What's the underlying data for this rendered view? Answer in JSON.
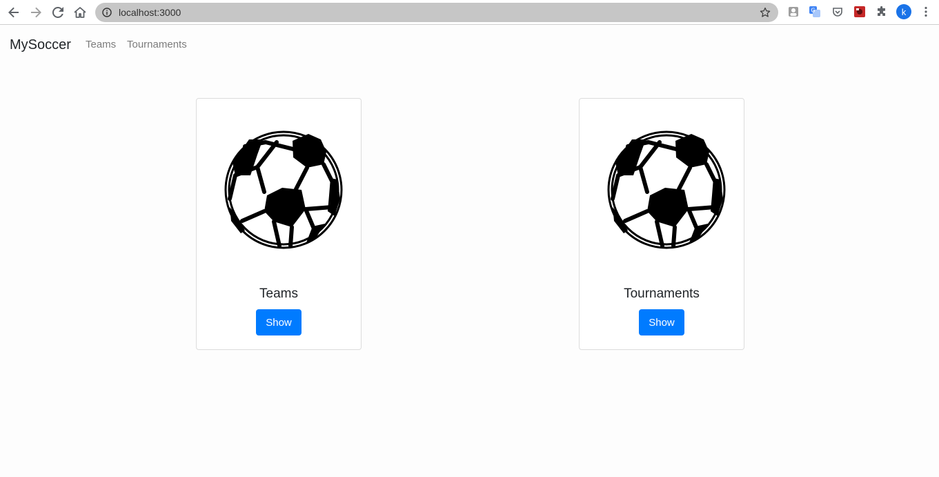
{
  "browser": {
    "url": "localhost:3000",
    "profile_initial": "k",
    "icons": [
      "back-icon",
      "forward-icon",
      "reload-icon",
      "home-icon",
      "info-icon",
      "bookmark-star-icon",
      "extension-profile-icon",
      "google-translate-icon",
      "pocket-icon",
      "extension-red-icon",
      "puzzle-icon",
      "menu-kebab-icon"
    ]
  },
  "navbar": {
    "brand": "MySoccer",
    "links": [
      "Teams",
      "Tournaments"
    ]
  },
  "cards": [
    {
      "title": "Teams",
      "button": "Show",
      "image_icon": "soccer-ball-icon"
    },
    {
      "title": "Tournaments",
      "button": "Show",
      "image_icon": "soccer-ball-icon"
    }
  ],
  "colors": {
    "primary": "#007bff",
    "text": "#212529",
    "nav_link": "#7c7c7c"
  }
}
